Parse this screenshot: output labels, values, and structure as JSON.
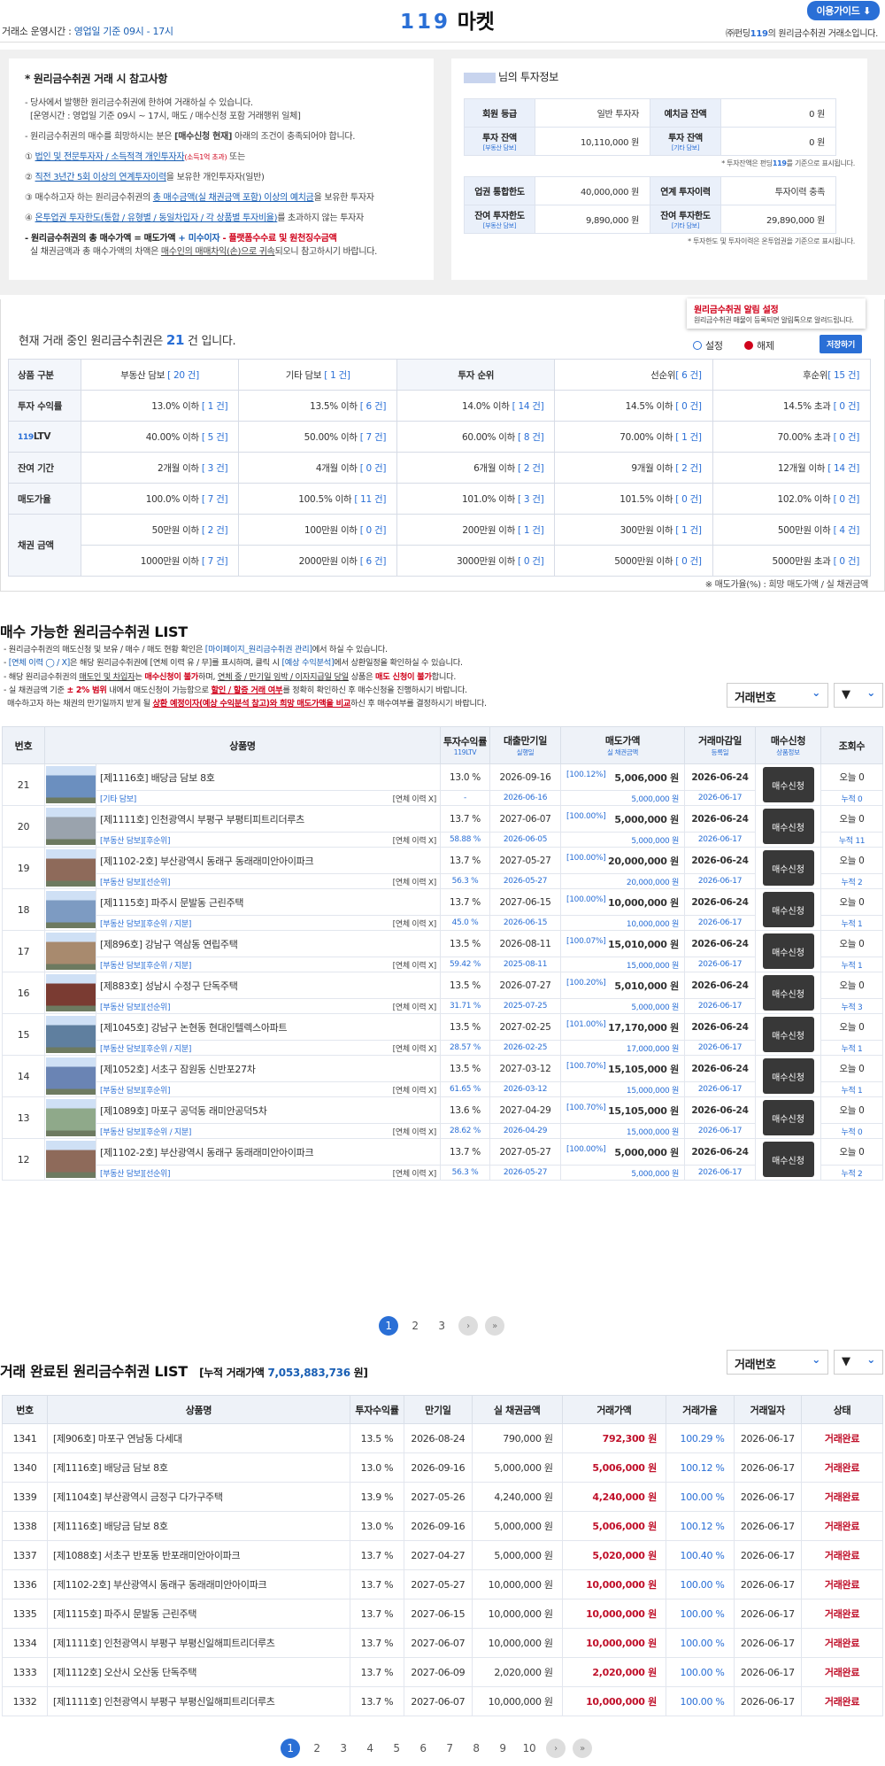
{
  "header": {
    "hours_label": "거래소 운영시간 : ",
    "hours_value": "영업일 기준 09시 - 17시",
    "logo_num": "119",
    "logo_text": "마켓",
    "guide": "이용가이드 ⬇",
    "corp_pre": "㈜펀딩",
    "corp_num": "119",
    "corp_post": "의 원리금수취권 거래소입니다."
  },
  "notice": {
    "title": "* 원리금수취권 거래 시 참고사항",
    "p1": "- 당사에서 발행한 원리금수취권에 한하여 거래하실 수 있습니다.",
    "p2": "[운영시간 : 영업일 기준 09시 ~ 17시, 매도 / 매수신청 포함 거래행위 일체]",
    "p3a": "- 원리금수취권의 매수를 희망하시는 분은 ",
    "p3b": "[매수신청 현재]",
    "p3c": " 아래의 조건이 충족되어야 합니다.",
    "c1a": "① ",
    "c1b": "법인 및 전문투자자 / 소득적격 개인투자자",
    "c1c": "(소득1억 초과)",
    "c1d": " 또는",
    "c2a": "② ",
    "c2b": "직전 3년간 5회 이상의 연계투자이력",
    "c2c": "을 보유한 개인투자자(일반)",
    "c3a": "③ 매수하고자 하는 원리금수취권의 ",
    "c3b": "총 매수금액(실 채권금액 포함) 이상의 예치금",
    "c3c": "을 보유한 투자자",
    "c4a": "④ ",
    "c4b": "온투업권 투자한도(통합 / 유형별 / 동일차입자 / 각 상품별 투자비율)",
    "c4c": "를 초과하지 않는 투자자",
    "f1a": "- 원리금수취권의 총 매수가액 = 매도가액",
    "f1b": " + 미수이자",
    "f1c": " - 플랫폼수수료 및 원천징수금액",
    "f2a": "실 채권금액과 총 매수가액의 차액은 ",
    "f2b": "매수인의 매매차익(손)으로 귀속",
    "f2c": "되오니 참고하시기 바랍니다."
  },
  "investor": {
    "title_suffix": "님의 투자정보",
    "t1": [
      [
        "회원 등급",
        "",
        "일반 투자자",
        "예치금 잔액",
        "",
        "0 원"
      ],
      [
        "투자 잔액",
        "[부동산 담보]",
        "10,110,000 원",
        "투자 잔액",
        "[기타 담보]",
        "0 원"
      ]
    ],
    "note1_pre": "* 투자잔액은 펀딩",
    "note1_num": "119",
    "note1_post": "를 기준으로 표시됩니다.",
    "t2": [
      [
        "업권 통합한도",
        "",
        "40,000,000 원",
        "연계 투자이력",
        "",
        "투자이력 충족"
      ],
      [
        "잔여 투자한도",
        "[부동산 담보]",
        "9,890,000 원",
        "잔여 투자한도",
        "[기타 담보]",
        "29,890,000 원"
      ]
    ],
    "note2": "* 투자한도 및 투자이력은 온투업권을 기준으로 표시됩니다."
  },
  "filter": {
    "count_pre": "현재 거래 중인 원리금수취권은 ",
    "count": "21",
    "count_post": " 건 입니다.",
    "alarm_title": "원리금수취권 알림 설정",
    "alarm_desc": "원리금수취권 매물이 등록되면 알림톡으로 알려드립니다.",
    "set": "설정",
    "unset": "해제",
    "save": "저장하기",
    "rows": [
      {
        "h": "상품 구분",
        "cells": [
          [
            "부동산 담보 ",
            "[ 20 건]"
          ],
          [
            "기타 담보 ",
            "[ 1 건]"
          ],
          [
            "투자 순위",
            ""
          ],
          [
            "선순위",
            "[ 6 건]"
          ],
          [
            "후순위",
            "[ 15 건]"
          ]
        ]
      },
      {
        "h": "투자 수익률",
        "cells": [
          [
            "13.0% 이하 ",
            "[ 1 건]"
          ],
          [
            "13.5% 이하 ",
            "[ 6 건]"
          ],
          [
            "14.0% 이하 ",
            "[ 14 건]"
          ],
          [
            "14.5% 이하 ",
            "[ 0 건]"
          ],
          [
            "14.5% 초과 ",
            "[ 0 건]"
          ]
        ]
      },
      {
        "h": "LTV",
        "hpre": "119",
        "cells": [
          [
            "40.00% 이하 ",
            "[ 5 건]"
          ],
          [
            "50.00% 이하 ",
            "[ 7 건]"
          ],
          [
            "60.00% 이하 ",
            "[ 8 건]"
          ],
          [
            "70.00% 이하 ",
            "[ 1 건]"
          ],
          [
            "70.00% 초과 ",
            "[ 0 건]"
          ]
        ]
      },
      {
        "h": "잔여 기간",
        "cells": [
          [
            "2개월 이하 ",
            "[ 3 건]"
          ],
          [
            "4개월 이하 ",
            "[ 0 건]"
          ],
          [
            "6개월 이하 ",
            "[ 2 건]"
          ],
          [
            "9개월 이하 ",
            "[ 2 건]"
          ],
          [
            "12개월 이하 ",
            "[ 14 건]"
          ]
        ]
      },
      {
        "h": "매도가율",
        "cells": [
          [
            "100.0% 이하 ",
            "[ 7 건]"
          ],
          [
            "100.5% 이하 ",
            "[ 11 건]"
          ],
          [
            "101.0% 이하 ",
            "[ 3 건]"
          ],
          [
            "101.5% 이하 ",
            "[ 0 건]"
          ],
          [
            "102.0% 이하 ",
            "[ 0 건]"
          ]
        ]
      }
    ],
    "amount_h": "채권 금액",
    "amount1": [
      [
        "50만원 이하 ",
        "[ 2 건]"
      ],
      [
        "100만원 이하 ",
        "[ 0 건]"
      ],
      [
        "200만원 이하 ",
        "[ 1 건]"
      ],
      [
        "300만원 이하 ",
        "[ 1 건]"
      ],
      [
        "500만원 이하 ",
        "[ 4 건]"
      ]
    ],
    "amount2": [
      [
        "1000만원 이하 ",
        "[ 7 건]"
      ],
      [
        "2000만원 이하 ",
        "[ 6 건]"
      ],
      [
        "3000만원 이하 ",
        "[ 0 건]"
      ],
      [
        "5000만원 이하 ",
        "[ 0 건]"
      ],
      [
        "5000만원 초과 ",
        "[ 0 건]"
      ]
    ],
    "footnote": "※ 매도가율(%) : 희망 매도가액 / 실 채권금액"
  },
  "list": {
    "title": "매수 가능한 원리금수취권 LIST",
    "n1a": "- 원리금수취권의 매도신청 및 보유 / 매수 / 매도 현황 확인은 ",
    "n1b": "[마이페이지_원리금수취권 관리]",
    "n1c": "에서 하실 수 있습니다.",
    "n2a": "- ",
    "n2b": "[연체 이력 ◯ / X]",
    "n2c": "은 해당 원리금수취권에 [연체 이력 유 / 무]를 표시하며, 클릭 시 ",
    "n2d": "[예상 수익분석]",
    "n2e": "에서 상환일정을 확인하실 수 있습니다.",
    "n3a": "- 해당 원리금수취권의 ",
    "n3b": "매도인 및 차입자",
    "n3c": "는 ",
    "n3d": "매수신청이 불가",
    "n3e": "하며, ",
    "n3f": "연체 중 / 만기일 임박 / 이자지급일 당일",
    "n3g": " 상품은 ",
    "n3h": "매도 신청이 불가",
    "n3i": "합니다.",
    "n4a": "- 실 채권금액 기준 ",
    "n4b": "± 2% 범위",
    "n4c": " 내에서 매도신청이 가능함으로 ",
    "n4d": "할인 / 할증 거래 여부",
    "n4e": "를 정확히 확인하신 후 매수신청을 진행하시기 바랍니다.",
    "n5a": "매수하고자 하는 채권의 만기일까지 받게 될 ",
    "n5b": "상환 예정이자(예상 수익분석 참고)와 희망 매도가액을 비교",
    "n5c": "하신 후 매수여부를 결정하시기 바랍니다.",
    "sort": "거래번호",
    "order": "▼",
    "headers": {
      "no": "번호",
      "name": "상품명",
      "rate": "투자수익률",
      "rate_sub": "LTV",
      "rate_sub_pre": "119",
      "due": "대출만기일",
      "due_sub": "실행일",
      "price": "매도가액",
      "price_sub": "실 채권금액",
      "close": "거래마감일",
      "close_sub": "등록일",
      "buy": "매수신청",
      "buy_sub": "상품정보",
      "views": "조회수"
    },
    "buy_label": "매수신청",
    "overdue": "[연체 이력  X]",
    "rows": [
      {
        "no": "21",
        "name": "[제1116호] 배당금 담보 8호",
        "tag": "[기타 담보]",
        "rate": "13.0 %",
        "ltv": "-",
        "due": "2026-09-16",
        "exec": "2026-06-16",
        "pct": "[100.12%]",
        "price": "5,006,000 원",
        "real": "5,000,000 원",
        "close": "2026-06-24",
        "reg": "2026-06-17",
        "views": "오늘 0",
        "total": "누적 0",
        "img": "#6b8fbf"
      },
      {
        "no": "20",
        "name": "[제1111호] 인천광역시 부평구 부평티피트리더루츠",
        "tag": "[부동산 담보][후순위]",
        "rate": "13.7 %",
        "ltv": "58.88 %",
        "due": "2027-06-07",
        "exec": "2026-06-05",
        "pct": "[100.00%]",
        "price": "5,000,000 원",
        "real": "5,000,000 원",
        "close": "2026-06-24",
        "reg": "2026-06-17",
        "views": "오늘 0",
        "total": "누적 11",
        "img": "#9aa3ad"
      },
      {
        "no": "19",
        "name": "[제1102-2호] 부산광역시 동래구 동래래미안아이파크",
        "tag": "[부동산 담보][선순위]",
        "rate": "13.7 %",
        "ltv": "56.3 %",
        "due": "2027-05-27",
        "exec": "2026-05-27",
        "pct": "[100.00%]",
        "price": "20,000,000 원",
        "real": "20,000,000 원",
        "close": "2026-06-24",
        "reg": "2026-06-17",
        "views": "오늘 0",
        "total": "누적 2",
        "img": "#8e6a5a"
      },
      {
        "no": "18",
        "name": "[제1115호] 파주시 문발동 근린주택",
        "tag": "[부동산 담보][후순위 / 지분]",
        "rate": "13.7 %",
        "ltv": "45.0 %",
        "due": "2027-06-15",
        "exec": "2026-06-15",
        "pct": "[100.00%]",
        "price": "10,000,000 원",
        "real": "10,000,000 원",
        "close": "2026-06-24",
        "reg": "2026-06-17",
        "views": "오늘 0",
        "total": "누적 1",
        "img": "#7d9bc2"
      },
      {
        "no": "17",
        "name": "[제896호] 강남구 역삼동 연립주택",
        "tag": "[부동산 담보][후순위 / 지분]",
        "rate": "13.5 %",
        "ltv": "59.42 %",
        "due": "2026-08-11",
        "exec": "2025-08-11",
        "pct": "[100.07%]",
        "price": "15,010,000 원",
        "real": "15,000,000 원",
        "close": "2026-06-24",
        "reg": "2026-06-17",
        "views": "오늘 0",
        "total": "누적 1",
        "img": "#a88a6e"
      },
      {
        "no": "16",
        "name": "[제883호] 성남시 수정구 단독주택",
        "tag": "[부동산 담보][선순위]",
        "rate": "13.5 %",
        "ltv": "31.71 %",
        "due": "2026-07-27",
        "exec": "2025-07-25",
        "pct": "[100.20%]",
        "price": "5,010,000 원",
        "real": "5,000,000 원",
        "close": "2026-06-24",
        "reg": "2026-06-17",
        "views": "오늘 0",
        "total": "누적 3",
        "img": "#7a3b32"
      },
      {
        "no": "15",
        "name": "[제1045호] 강남구 논현동 현대인텔렉스아파트",
        "tag": "[부동산 담보][후순위 / 지분]",
        "rate": "13.5 %",
        "ltv": "28.57 %",
        "due": "2027-02-25",
        "exec": "2026-02-25",
        "pct": "[101.00%]",
        "price": "17,170,000 원",
        "real": "17,000,000 원",
        "close": "2026-06-24",
        "reg": "2026-06-17",
        "views": "오늘 0",
        "total": "누적 1",
        "img": "#5f7f9f"
      },
      {
        "no": "14",
        "name": "[제1052호] 서초구 잠원동 신반포27차",
        "tag": "[부동산 담보][후순위]",
        "rate": "13.5 %",
        "ltv": "61.65 %",
        "due": "2027-03-12",
        "exec": "2026-03-12",
        "pct": "[100.70%]",
        "price": "15,105,000 원",
        "real": "15,000,000 원",
        "close": "2026-06-24",
        "reg": "2026-06-17",
        "views": "오늘 0",
        "total": "누적 1",
        "img": "#6a84b4"
      },
      {
        "no": "13",
        "name": "[제1089호] 마포구 공덕동 래미안공덕5차",
        "tag": "[부동산 담보][후순위 / 지분]",
        "rate": "13.6 %",
        "ltv": "28.62 %",
        "due": "2027-04-29",
        "exec": "2026-04-29",
        "pct": "[100.70%]",
        "price": "15,105,000 원",
        "real": "15,000,000 원",
        "close": "2026-06-24",
        "reg": "2026-06-17",
        "views": "오늘 0",
        "total": "누적 0",
        "img": "#8fa98a"
      },
      {
        "no": "12",
        "name": "[제1102-2호] 부산광역시 동래구 동래래미안아이파크",
        "tag": "[부동산 담보][선순위]",
        "rate": "13.7 %",
        "ltv": "56.3 %",
        "due": "2027-05-27",
        "exec": "2026-05-27",
        "pct": "[100.00%]",
        "price": "5,000,000 원",
        "real": "5,000,000 원",
        "close": "2026-06-24",
        "reg": "2026-06-17",
        "views": "오늘 0",
        "total": "누적 2",
        "img": "#8e6a5a"
      }
    ],
    "pages": [
      "1",
      "2",
      "3"
    ]
  },
  "done": {
    "title": "거래 완료된 원리금수취권 LIST",
    "total_pre": "[누적 거래가액 ",
    "total": "7,053,883,736",
    "total_post": " 원]",
    "sort": "거래번호",
    "order": "▼",
    "headers": [
      "번호",
      "상품명",
      "투자수익률",
      "만기일",
      "실 채권금액",
      "거래가액",
      "거래가율",
      "거래일자",
      "상태"
    ],
    "rows": [
      [
        "1341",
        "[제906호] 마포구 연남동 다세대",
        "13.5 %",
        "2026-08-24",
        "790,000 원",
        "792,300 원",
        "100.29 %",
        "2026-06-17",
        "거래완료"
      ],
      [
        "1340",
        "[제1116호] 배당금 담보 8호",
        "13.0 %",
        "2026-09-16",
        "5,000,000 원",
        "5,006,000 원",
        "100.12 %",
        "2026-06-17",
        "거래완료"
      ],
      [
        "1339",
        "[제1104호] 부산광역시 금정구 다가구주택",
        "13.9 %",
        "2027-05-26",
        "4,240,000 원",
        "4,240,000 원",
        "100.00 %",
        "2026-06-17",
        "거래완료"
      ],
      [
        "1338",
        "[제1116호] 배당금 담보 8호",
        "13.0 %",
        "2026-09-16",
        "5,000,000 원",
        "5,006,000 원",
        "100.12 %",
        "2026-06-17",
        "거래완료"
      ],
      [
        "1337",
        "[제1088호] 서초구 반포동 반포래미안아이파크",
        "13.7 %",
        "2027-04-27",
        "5,000,000 원",
        "5,020,000 원",
        "100.40 %",
        "2026-06-17",
        "거래완료"
      ],
      [
        "1336",
        "[제1102-2호] 부산광역시 동래구 동래래미안아이파크",
        "13.7 %",
        "2027-05-27",
        "10,000,000 원",
        "10,000,000 원",
        "100.00 %",
        "2026-06-17",
        "거래완료"
      ],
      [
        "1335",
        "[제1115호] 파주시 문발동 근린주택",
        "13.7 %",
        "2027-06-15",
        "10,000,000 원",
        "10,000,000 원",
        "100.00 %",
        "2026-06-17",
        "거래완료"
      ],
      [
        "1334",
        "[제1111호] 인천광역시 부평구 부평신일해피트리더루츠",
        "13.7 %",
        "2027-06-07",
        "10,000,000 원",
        "10,000,000 원",
        "100.00 %",
        "2026-06-17",
        "거래완료"
      ],
      [
        "1333",
        "[제1112호] 오산시 오산동 단독주택",
        "13.7 %",
        "2027-06-09",
        "2,020,000 원",
        "2,020,000 원",
        "100.00 %",
        "2026-06-17",
        "거래완료"
      ],
      [
        "1332",
        "[제1111호] 인천광역시 부평구 부평신일해피트리더루츠",
        "13.7 %",
        "2027-06-07",
        "10,000,000 원",
        "10,000,000 원",
        "100.00 %",
        "2026-06-17",
        "거래완료"
      ]
    ],
    "pages": [
      "1",
      "2",
      "3",
      "4",
      "5",
      "6",
      "7",
      "8",
      "9",
      "10"
    ]
  },
  "colors": {
    "accent": "#2a6fd6",
    "red": "#d0021b",
    "button": "#383838"
  }
}
